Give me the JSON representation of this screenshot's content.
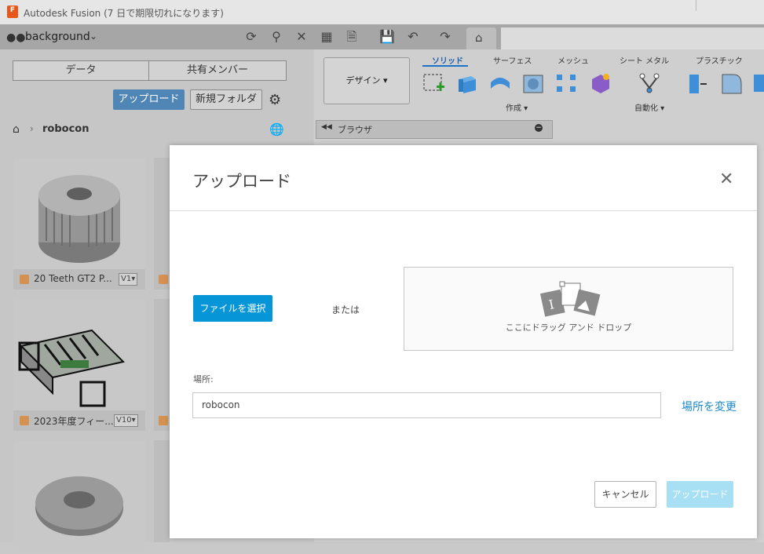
{
  "window": {
    "title": "Autodesk Fusion (7 日で期限切れになります)",
    "logo_letter": "F"
  },
  "topbar": {
    "team_name": "background"
  },
  "left_panel": {
    "tabs": [
      "データ",
      "共有メンバー"
    ],
    "upload_label": "アップロード",
    "new_folder_label": "新規フォルダ",
    "breadcrumb": "robocon",
    "items": [
      {
        "name": "20 Teeth GT2 P...",
        "version": "V1"
      },
      {
        "name": "2023年度フィー...",
        "version": "V10"
      }
    ]
  },
  "workspace": {
    "design_label": "デザイン",
    "tabs": [
      "ソリッド",
      "サーフェス",
      "メッシュ",
      "シート メタル",
      "プラスチック"
    ],
    "active_tab": "ソリッド",
    "create_label": "作成",
    "automate_label": "自動化",
    "browser_label": "ブラウザ"
  },
  "modal": {
    "title": "アップロード",
    "choose_file_label": "ファイルを選択",
    "or_label": "または",
    "drop_label": "ここにドラッグ アンド ドロップ",
    "location_label": "場所:",
    "location_value": "robocon",
    "change_location_label": "場所を変更",
    "cancel_label": "キャンセル",
    "upload_label": "アップロード"
  },
  "colors": {
    "accent": "#0696d7",
    "upload_disabled": "#a7dff5",
    "link": "#1e88c7",
    "panel_upload": "#4f86b6"
  }
}
